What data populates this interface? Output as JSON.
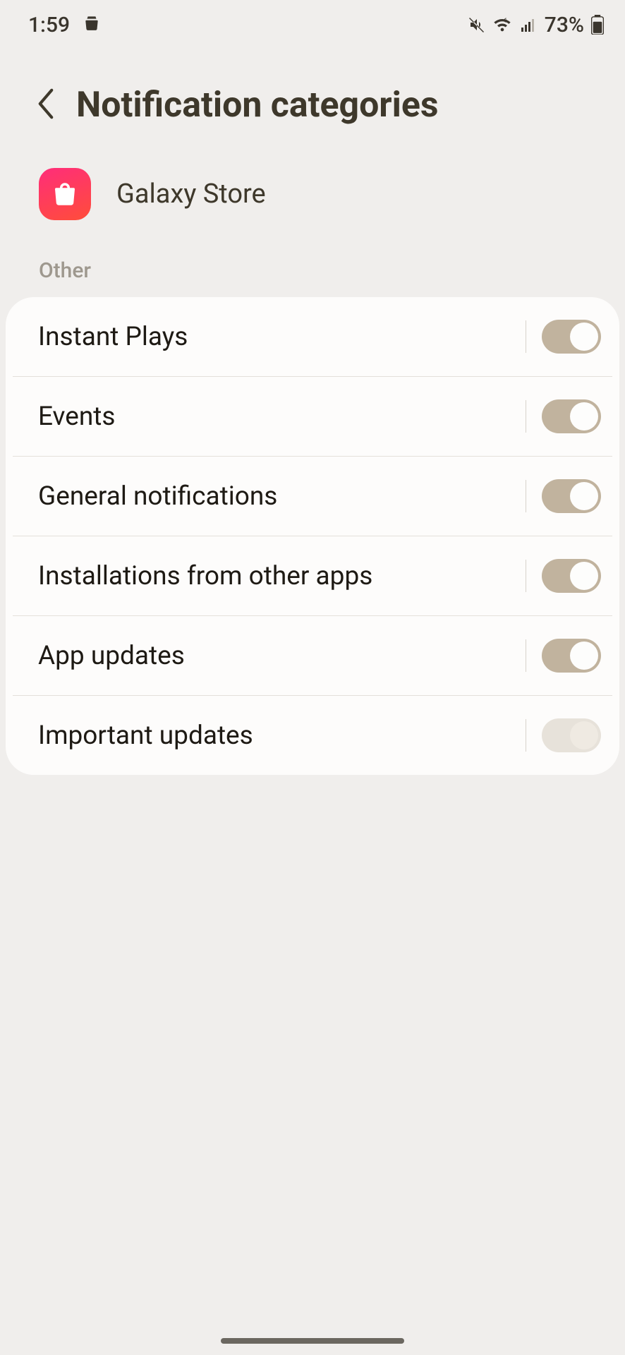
{
  "status": {
    "time": "1:59",
    "battery_text": "73%"
  },
  "header": {
    "title": "Notification categories"
  },
  "app": {
    "name": "Galaxy Store"
  },
  "section_label": "Other",
  "rows": [
    {
      "label": "Instant Plays",
      "on": true
    },
    {
      "label": "Events",
      "on": true
    },
    {
      "label": "General notifications",
      "on": true
    },
    {
      "label": "Installations from other apps",
      "on": true
    },
    {
      "label": "App updates",
      "on": true
    },
    {
      "label": "Important updates",
      "on": false
    }
  ]
}
